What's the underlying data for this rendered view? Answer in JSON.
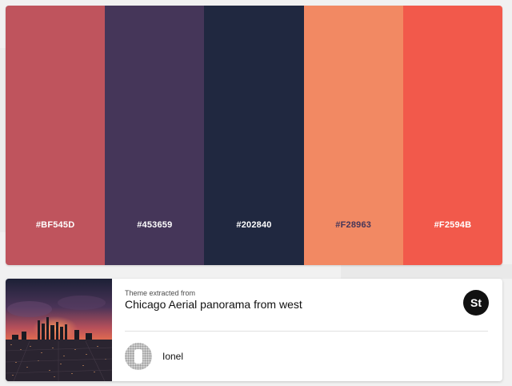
{
  "palette": {
    "swatches": [
      {
        "hex": "#BF545D",
        "color": "#BF545D",
        "label_color": "#ffffff"
      },
      {
        "hex": "#453659",
        "color": "#453659",
        "label_color": "#ffffff"
      },
      {
        "hex": "#202840",
        "color": "#202840",
        "label_color": "#ffffff"
      },
      {
        "hex": "#F28963",
        "color": "#F28963",
        "label_color": "#453659"
      },
      {
        "hex": "#F2594B",
        "color": "#F2594B",
        "label_color": "#ffffff"
      }
    ]
  },
  "theme": {
    "caption": "Theme extracted from",
    "title": "Chicago Aerial panorama from west",
    "stock_badge": "St",
    "user_name": "Ionel"
  }
}
